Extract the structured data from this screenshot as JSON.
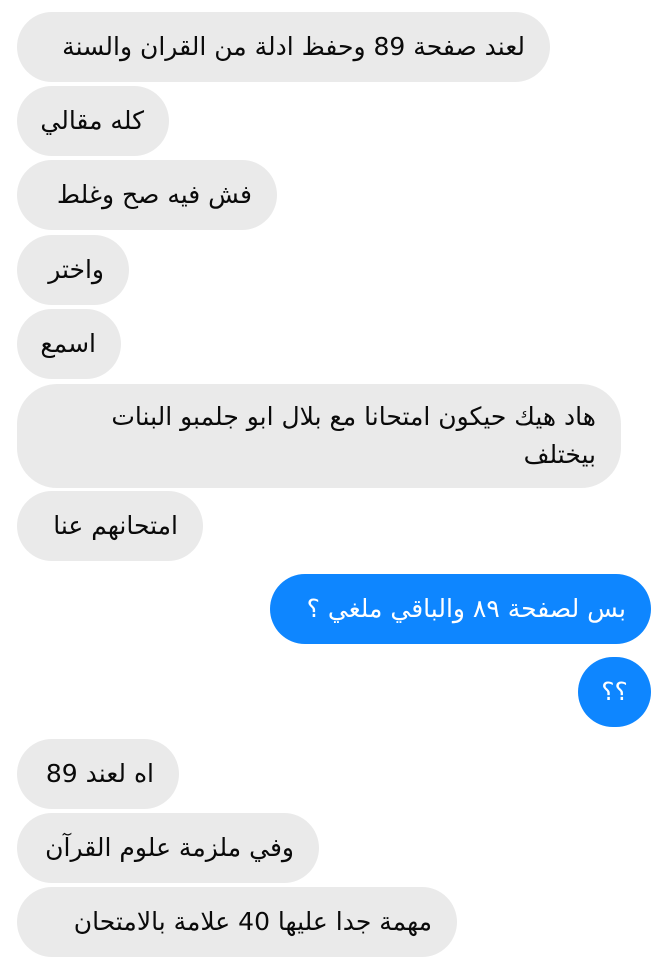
{
  "messages": [
    {
      "side": "received",
      "text": "لعند صفحة 89 وحفظ ادلة من القران والسنة"
    },
    {
      "side": "received",
      "text": "كله مقالي"
    },
    {
      "side": "received",
      "text": "فش فيه صح وغلط"
    },
    {
      "side": "received",
      "text": "واختر"
    },
    {
      "side": "received",
      "text": "اسمع"
    },
    {
      "side": "received",
      "lines": [
        "هاد هيك حيكون امتحانا مع بلال ابو جلمبو البنات",
        "بيختلف"
      ]
    },
    {
      "side": "received",
      "text": "امتحانهم عنا"
    },
    {
      "side": "sent",
      "text": "بس لصفحة ٨٩ والباقي ملغي ؟"
    },
    {
      "side": "sent",
      "text": "؟؟"
    },
    {
      "side": "received",
      "text": "اه لعند 89"
    },
    {
      "side": "received",
      "text": "وفي ملزمة علوم القرآن"
    },
    {
      "side": "received",
      "text": "مهمة جدا عليها 40 علامة بالامتحان"
    }
  ],
  "colors": {
    "received_bubble": "#eaeaea",
    "sent_bubble": "#0e86ff",
    "received_text": "#0a0a0a",
    "sent_text": "#ffffff"
  }
}
